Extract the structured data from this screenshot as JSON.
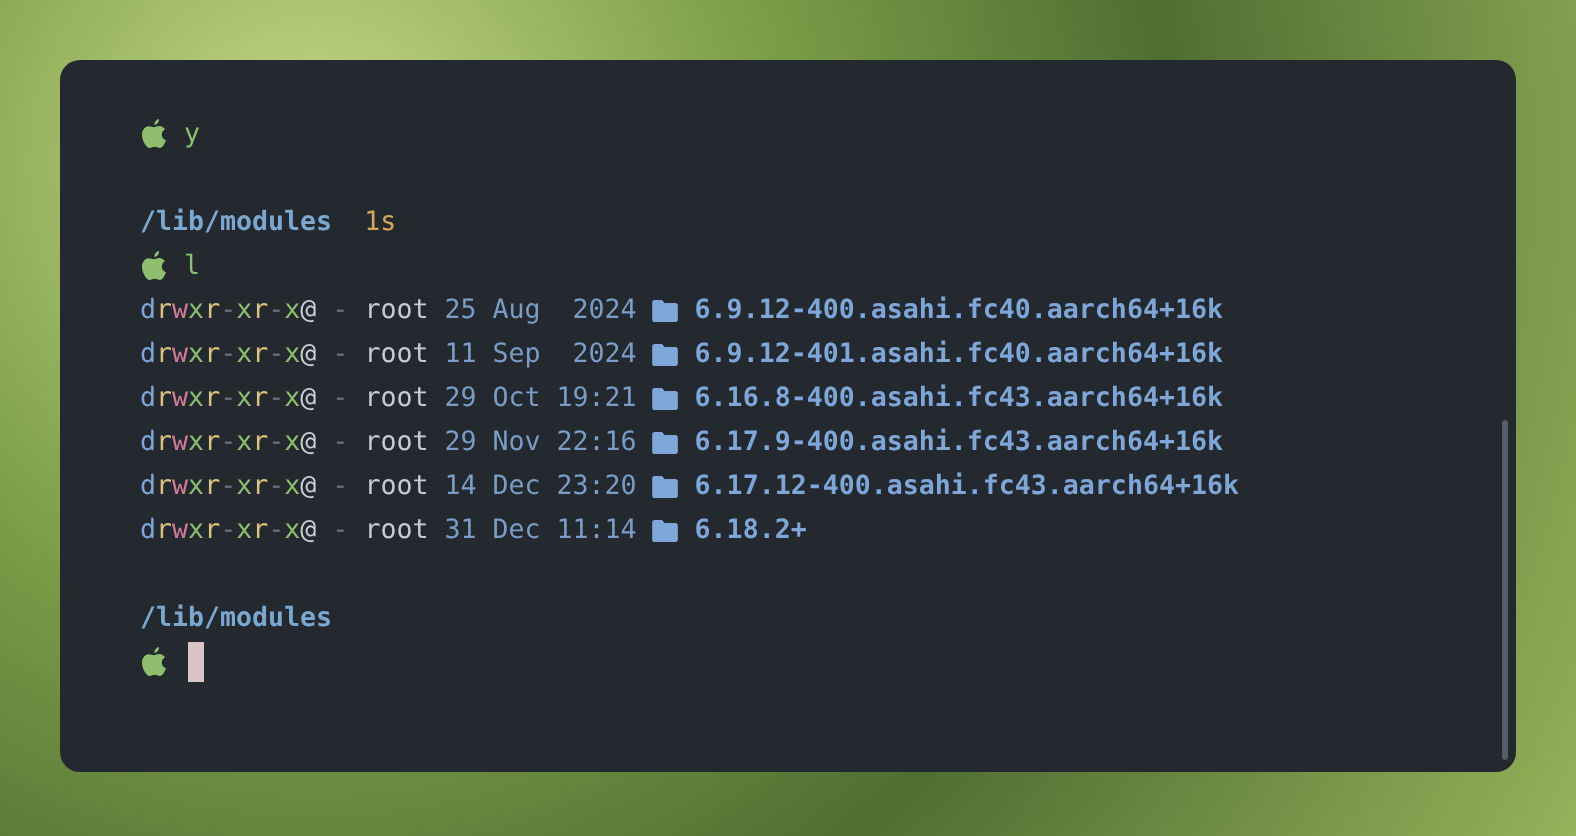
{
  "terminal": {
    "lines": [
      {
        "kind": "prompt",
        "command": "y"
      },
      {
        "kind": "blank"
      },
      {
        "kind": "path",
        "path": "/lib/modules",
        "duration": "1s"
      },
      {
        "kind": "prompt",
        "command": "l"
      },
      {
        "kind": "entry",
        "permissions": "drwxr-xr-x@",
        "size": "-",
        "user": "root",
        "date": "25 Aug  2024",
        "name": "6.9.12-400.asahi.fc40.aarch64+16k"
      },
      {
        "kind": "entry",
        "permissions": "drwxr-xr-x@",
        "size": "-",
        "user": "root",
        "date": "11 Sep  2024",
        "name": "6.9.12-401.asahi.fc40.aarch64+16k"
      },
      {
        "kind": "entry",
        "permissions": "drwxr-xr-x@",
        "size": "-",
        "user": "root",
        "date": "29 Oct 19:21",
        "name": "6.16.8-400.asahi.fc43.aarch64+16k"
      },
      {
        "kind": "entry",
        "permissions": "drwxr-xr-x@",
        "size": "-",
        "user": "root",
        "date": "29 Nov 22:16",
        "name": "6.17.9-400.asahi.fc43.aarch64+16k"
      },
      {
        "kind": "entry",
        "permissions": "drwxr-xr-x@",
        "size": "-",
        "user": "root",
        "date": "14 Dec 23:20",
        "name": "6.17.12-400.asahi.fc43.aarch64+16k"
      },
      {
        "kind": "entry",
        "permissions": "drwxr-xr-x@",
        "size": "-",
        "user": "root",
        "date": "31 Dec 11:14",
        "name": "6.18.2+"
      },
      {
        "kind": "blank"
      },
      {
        "kind": "path",
        "path": "/lib/modules"
      },
      {
        "kind": "prompt",
        "cursor": true
      }
    ]
  }
}
